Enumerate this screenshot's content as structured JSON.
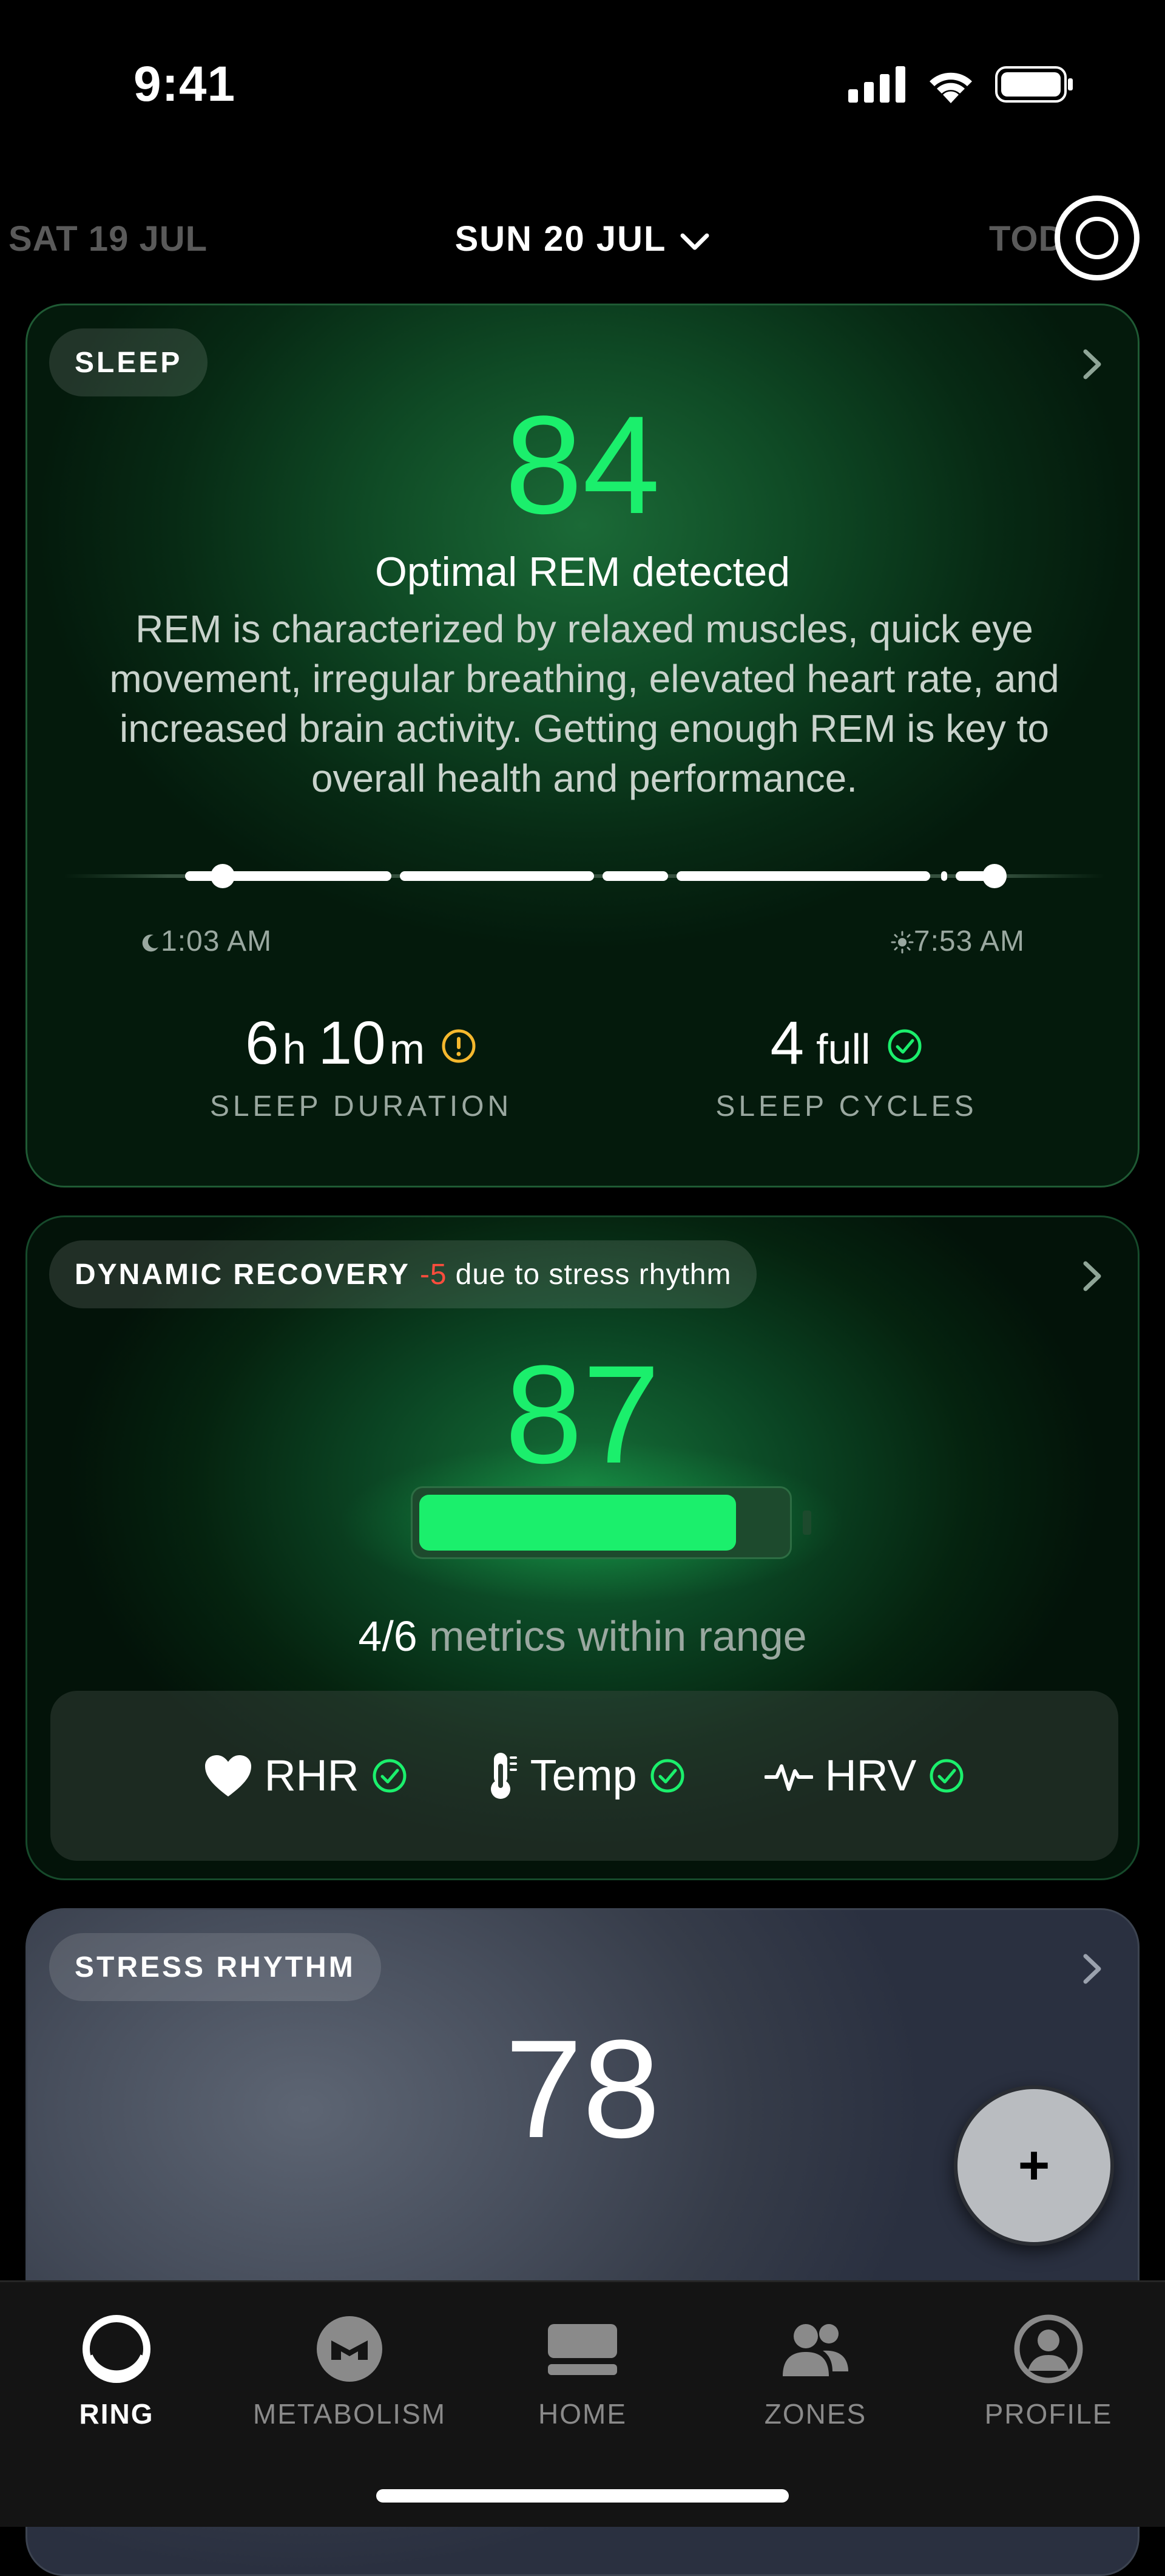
{
  "status_bar": {
    "time": "9:41"
  },
  "date_nav": {
    "previous": "SAT 19 JUL",
    "current": "SUN 20 JUL",
    "next": "TOD"
  },
  "sleep_card": {
    "label": "SLEEP",
    "score": "84",
    "headline": "Optimal REM detected",
    "description": "REM is characterized by relaxed muscles, quick eye movement, irregular breathing, elevated heart rate, and increased brain activity. Getting enough REM is key to overall health and performance.",
    "sleep_start": "1:03 AM",
    "wake_time": "7:53 AM",
    "duration": {
      "hours": "6",
      "hours_unit": "h",
      "minutes": "10",
      "minutes_unit": "m",
      "label": "SLEEP DURATION",
      "status_icon": "warning-icon"
    },
    "cycles": {
      "value": "4",
      "unit": "full",
      "label": "SLEEP CYCLES",
      "status_icon": "check-icon"
    }
  },
  "recovery_card": {
    "label": "DYNAMIC RECOVERY",
    "adjustment": "-5",
    "adjustment_note": "due to stress rhythm",
    "score": "87",
    "battery_level": 0.87,
    "metrics_count": "4/6",
    "metrics_text": "metrics within range",
    "metrics": [
      {
        "name": "RHR",
        "icon": "heart-icon"
      },
      {
        "name": "Temp",
        "icon": "thermometer-icon"
      },
      {
        "name": "HRV",
        "icon": "pulse-icon"
      }
    ]
  },
  "stress_card": {
    "label": "STRESS RHYTHM",
    "score": "78"
  },
  "fab": {
    "label": "+"
  },
  "tab_bar": {
    "tabs": [
      {
        "label": "RING",
        "icon": "ring-icon",
        "active": true
      },
      {
        "label": "METABOLISM",
        "icon": "metabolism-icon",
        "active": false
      },
      {
        "label": "HOME",
        "icon": "home-icon",
        "active": false
      },
      {
        "label": "ZONES",
        "icon": "zones-icon",
        "active": false
      },
      {
        "label": "PROFILE",
        "icon": "profile-icon",
        "active": false
      }
    ]
  },
  "colors": {
    "accent_green": "#1bef6c",
    "warning": "#f5b82e",
    "negative": "#ff4d3d"
  }
}
